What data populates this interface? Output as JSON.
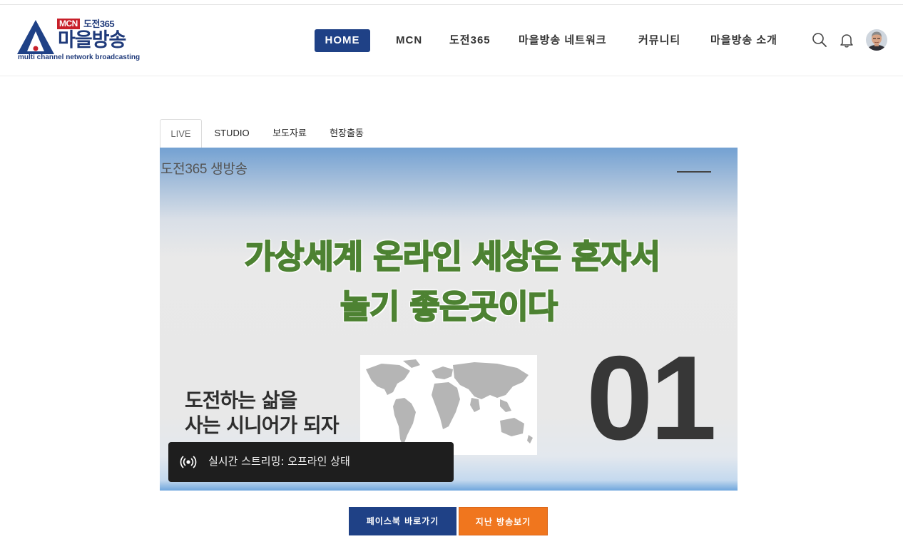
{
  "logo": {
    "badge": "MCN",
    "badge_suffix": "도전365",
    "name": "마을방송",
    "tagline": "multi channel network broadcasting"
  },
  "nav": {
    "items": [
      "HOME",
      "MCN",
      "도전365",
      "마을방송 네트워크",
      "커뮤니티",
      "마을방송 소개"
    ],
    "active": "HOME"
  },
  "header_icons": [
    "search-icon",
    "bell-icon",
    "avatar"
  ],
  "tabs": {
    "items": [
      "LIVE",
      "STUDIO",
      "보도자료",
      "현장출동"
    ],
    "active": "LIVE"
  },
  "player": {
    "title": "도전365 생방송",
    "headline_line1": "가상세계 온라인 세상은 혼자서",
    "headline_line2": "놀기 좋은곳이다",
    "sub_line1": "도전하는 삶을",
    "sub_line2": "사는 시니어가 되자",
    "episode_number": "01",
    "status_text": "실시간 스트리밍: 오프라인 상태"
  },
  "buttons": {
    "facebook": "페이스북 바로가기",
    "past_broadcast": "지난 방송보기"
  },
  "colors": {
    "brand_blue": "#1f4186",
    "brand_red": "#c8202a",
    "accent_orange": "#f0761e",
    "headline_green": "#558a3a"
  }
}
